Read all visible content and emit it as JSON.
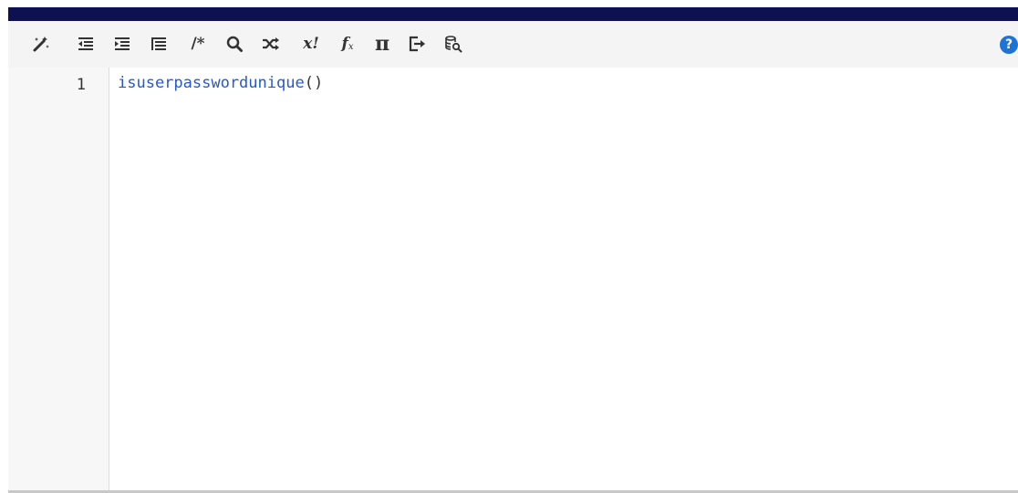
{
  "toolbar": {
    "buttons": [
      {
        "name": "magic-wand-icon",
        "label": ""
      },
      {
        "name": "outdent-icon",
        "label": ""
      },
      {
        "name": "indent-icon",
        "label": ""
      },
      {
        "name": "format-list-icon",
        "label": ""
      },
      {
        "name": "comment-icon",
        "label": "/*"
      },
      {
        "name": "search-icon",
        "label": ""
      },
      {
        "name": "shuffle-icon",
        "label": ""
      },
      {
        "name": "factorial-icon",
        "label": "x!"
      },
      {
        "name": "function-icon",
        "label": "f"
      },
      {
        "name": "pi-icon",
        "label": "π"
      },
      {
        "name": "export-icon",
        "label": ""
      },
      {
        "name": "database-search-icon",
        "label": ""
      }
    ],
    "help_label": "?"
  },
  "editor": {
    "line_number": "1",
    "code": {
      "function_name": "isuserpasswordunique",
      "parens": "()"
    }
  },
  "colors": {
    "topbar": "#0d1152",
    "function": "#2459cf",
    "help": "#1e74d6"
  }
}
